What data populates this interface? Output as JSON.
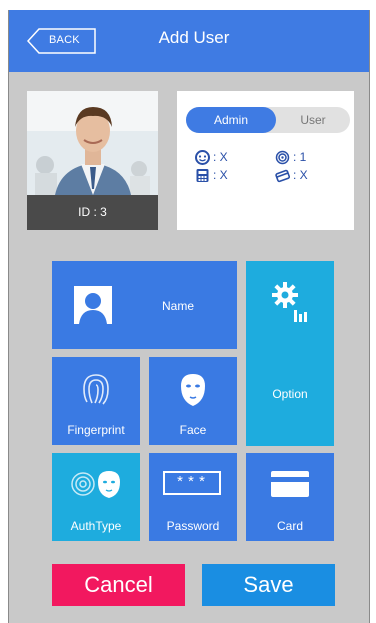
{
  "header": {
    "back_label": "BACK",
    "title": "Add User"
  },
  "profile": {
    "id_label": "ID : 3"
  },
  "role_toggle": {
    "selected": "Admin",
    "options": [
      "Admin",
      "User"
    ]
  },
  "stats": {
    "face": ": X",
    "fingerprint": ": 1",
    "password": ": X",
    "card": ": X"
  },
  "tiles": {
    "name": "Name",
    "option": "Option",
    "fingerprint": "Fingerprint",
    "face": "Face",
    "authtype": "AuthType",
    "password": "Password",
    "password_mask": "***",
    "card": "Card"
  },
  "actions": {
    "cancel": "Cancel",
    "save": "Save"
  },
  "colors": {
    "primary": "#3f7be3",
    "cyan": "#1eacde",
    "cancel": "#f2185f",
    "save": "#1a8ee2"
  }
}
